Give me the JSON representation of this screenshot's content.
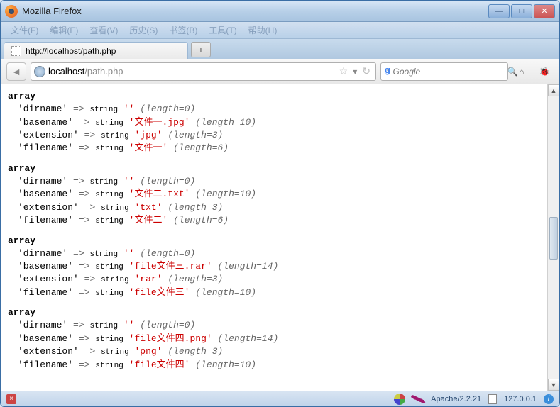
{
  "window": {
    "title": "Mozilla Firefox"
  },
  "menu": [
    {
      "label": "文件(F)"
    },
    {
      "label": "编辑(E)"
    },
    {
      "label": "查看(V)"
    },
    {
      "label": "历史(S)"
    },
    {
      "label": "书签(B)"
    },
    {
      "label": "工具(T)"
    },
    {
      "label": "帮助(H)"
    }
  ],
  "tab": {
    "title": "http://localhost/path.php"
  },
  "addressbar": {
    "host": "localhost",
    "path": "/path.php"
  },
  "search": {
    "placeholder": "Google",
    "dropdown": "▾"
  },
  "arrays": [
    {
      "rows": [
        {
          "key": "dirname",
          "value": "",
          "length": 0
        },
        {
          "key": "basename",
          "value": "文件一.jpg",
          "length": 10
        },
        {
          "key": "extension",
          "value": "jpg",
          "length": 3
        },
        {
          "key": "filename",
          "value": "文件一",
          "length": 6
        }
      ]
    },
    {
      "rows": [
        {
          "key": "dirname",
          "value": "",
          "length": 0
        },
        {
          "key": "basename",
          "value": "文件二.txt",
          "length": 10
        },
        {
          "key": "extension",
          "value": "txt",
          "length": 3
        },
        {
          "key": "filename",
          "value": "文件二",
          "length": 6
        }
      ]
    },
    {
      "rows": [
        {
          "key": "dirname",
          "value": "",
          "length": 0
        },
        {
          "key": "basename",
          "value": "file文件三.rar",
          "length": 14
        },
        {
          "key": "extension",
          "value": "rar",
          "length": 3
        },
        {
          "key": "filename",
          "value": "file文件三",
          "length": 10
        }
      ]
    },
    {
      "rows": [
        {
          "key": "dirname",
          "value": "",
          "length": 0
        },
        {
          "key": "basename",
          "value": "file文件四.png",
          "length": 14
        },
        {
          "key": "extension",
          "value": "png",
          "length": 3
        },
        {
          "key": "filename",
          "value": "file文件四",
          "length": 10
        }
      ]
    }
  ],
  "labels": {
    "array_head": "array",
    "type": "string",
    "arrow": "=>",
    "length_prefix": "length="
  },
  "status": {
    "server": "Apache/2.2.21",
    "ip": "127.0.0.1"
  }
}
